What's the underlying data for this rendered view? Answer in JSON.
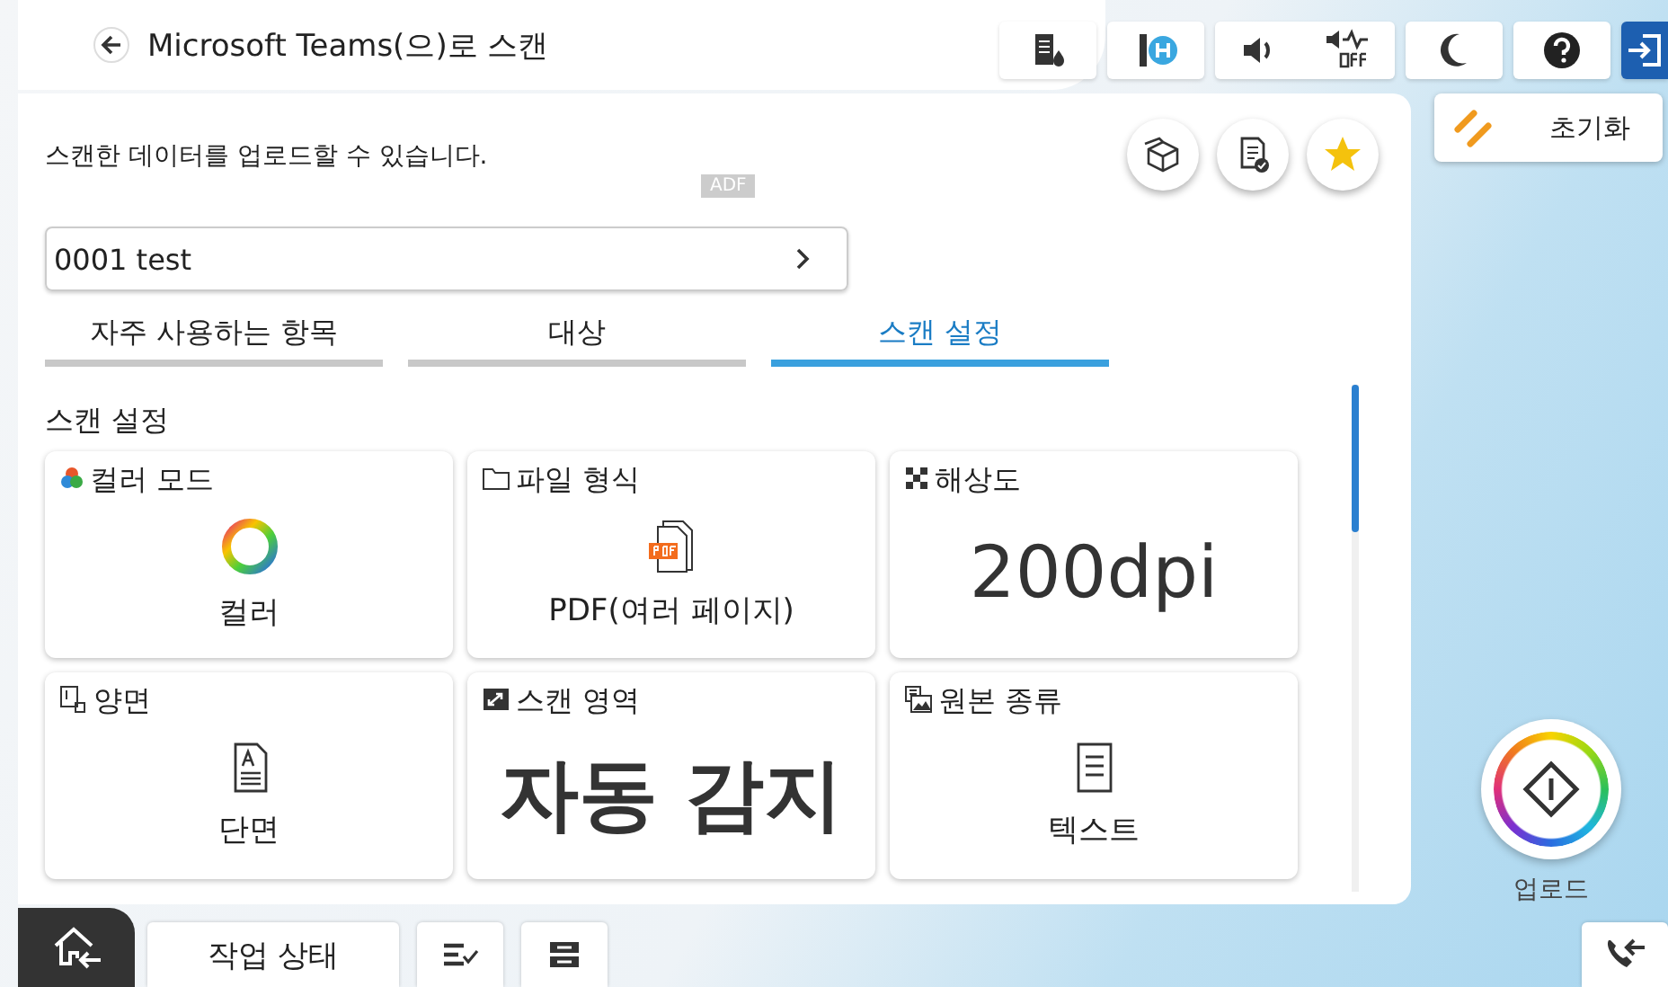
{
  "header": {
    "title": "Microsoft Teams(으)로 스캔"
  },
  "reset_button": {
    "label": "초기화"
  },
  "panel": {
    "message": "스캔한 데이터를 업로드할 수 있습니다.",
    "source_badge": "ADF",
    "destination": {
      "value": "0001 test"
    },
    "tabs": [
      {
        "label": "자주 사용하는 항목",
        "selected": false
      },
      {
        "label": "대상",
        "selected": false
      },
      {
        "label": "스캔 설정",
        "selected": true
      }
    ],
    "section_title": "스캔 설정",
    "settings": [
      {
        "label": "컬러 모드",
        "value": "컬러",
        "kind": "icon"
      },
      {
        "label": "파일 형식",
        "value": "PDF(여러 페이지)",
        "kind": "icon"
      },
      {
        "label": "해상도",
        "value": "200dpi",
        "kind": "large"
      },
      {
        "label": "양면",
        "value": "단면",
        "kind": "icon"
      },
      {
        "label": "스캔 영역",
        "value": "자동 감지",
        "kind": "large"
      },
      {
        "label": "원본 종류",
        "value": "텍스트",
        "kind": "icon"
      }
    ]
  },
  "upload_button": {
    "label": "업로드"
  },
  "bottom_bar": {
    "job_status": "작업 상태"
  }
}
